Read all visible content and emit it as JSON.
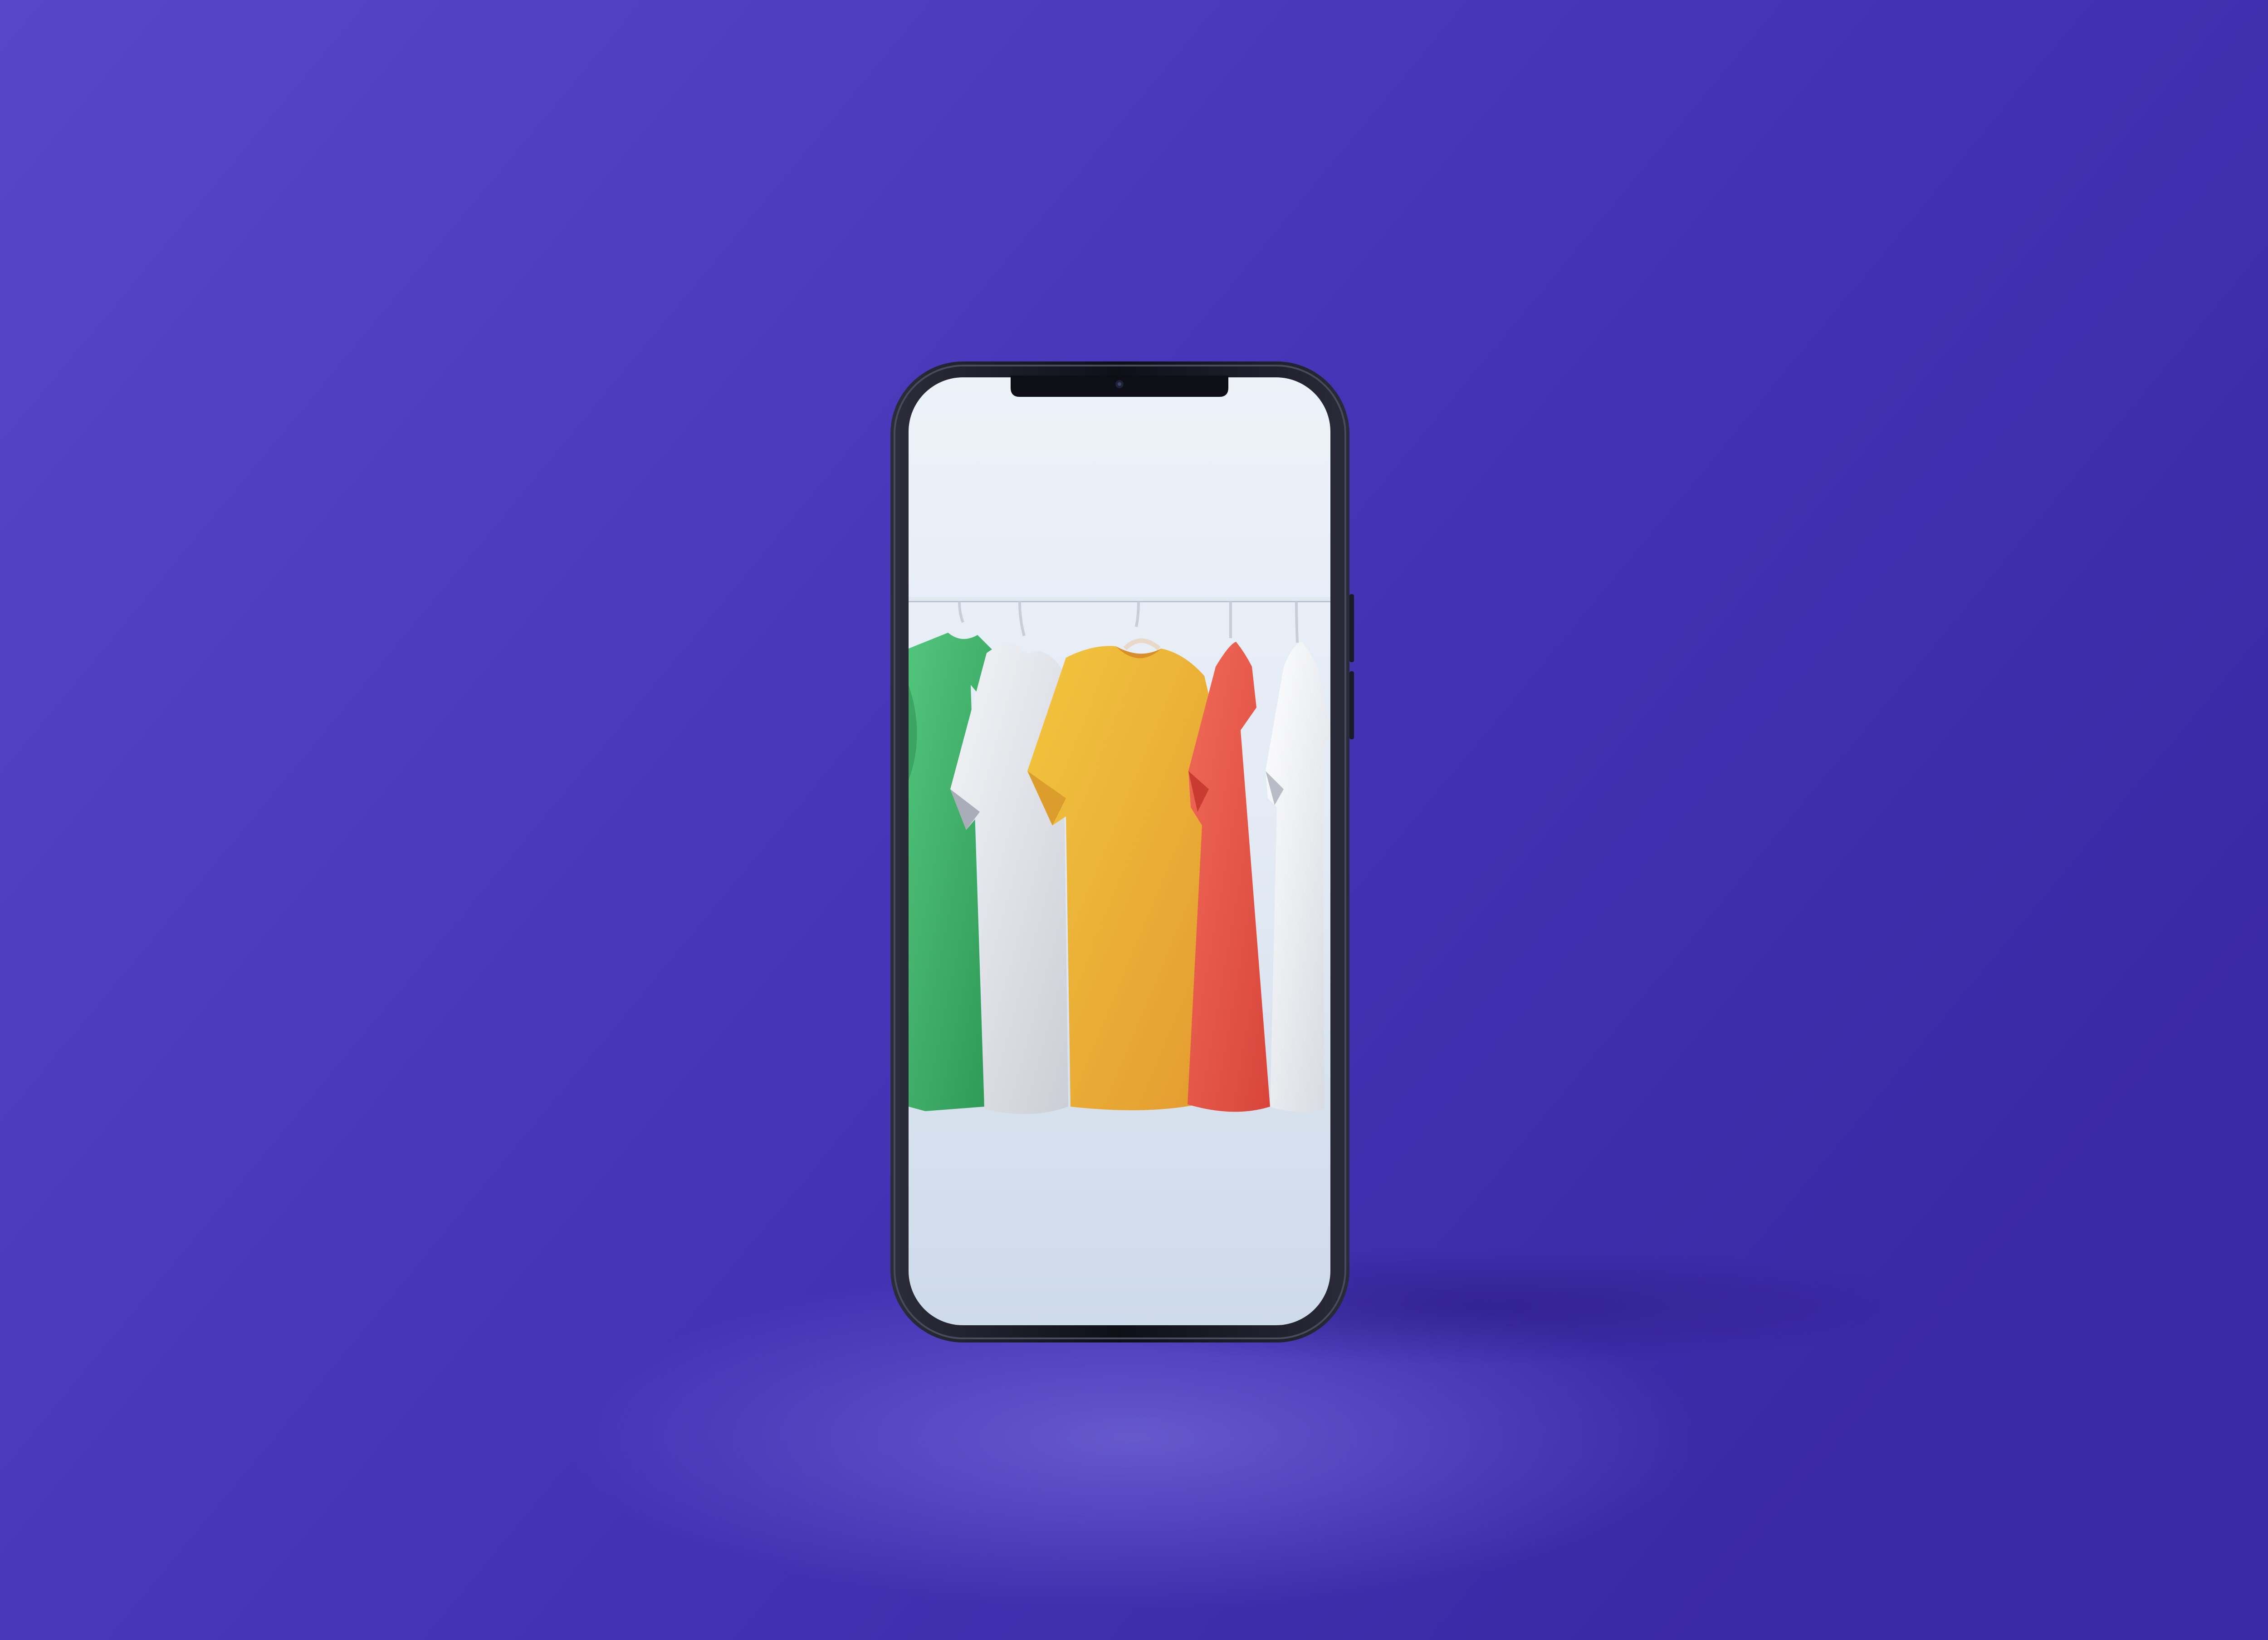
{
  "scene": {
    "subject": "smartphone",
    "screen_content": "clothing-rack"
  },
  "colors": {
    "background_left": "#5644c4",
    "background_right": "#3d29a6",
    "floor_glow": "#6a5cd0",
    "phone_frame": "#141420",
    "phone_frame_edge": "#3a3a48",
    "screen_light": "#eaf0f8",
    "screen_shade": "#c9d6e8",
    "rack_rail": "#dfe6ef",
    "shirt_green": "#3fb36a",
    "shirt_white": "#e9eaee",
    "shirt_yellow": "#eab23a",
    "shirt_red": "#e65a4a",
    "shirt_white_2": "#f1f2f5"
  },
  "shirts": [
    {
      "color": "green"
    },
    {
      "color": "white"
    },
    {
      "color": "yellow"
    },
    {
      "color": "red"
    },
    {
      "color": "white"
    }
  ]
}
